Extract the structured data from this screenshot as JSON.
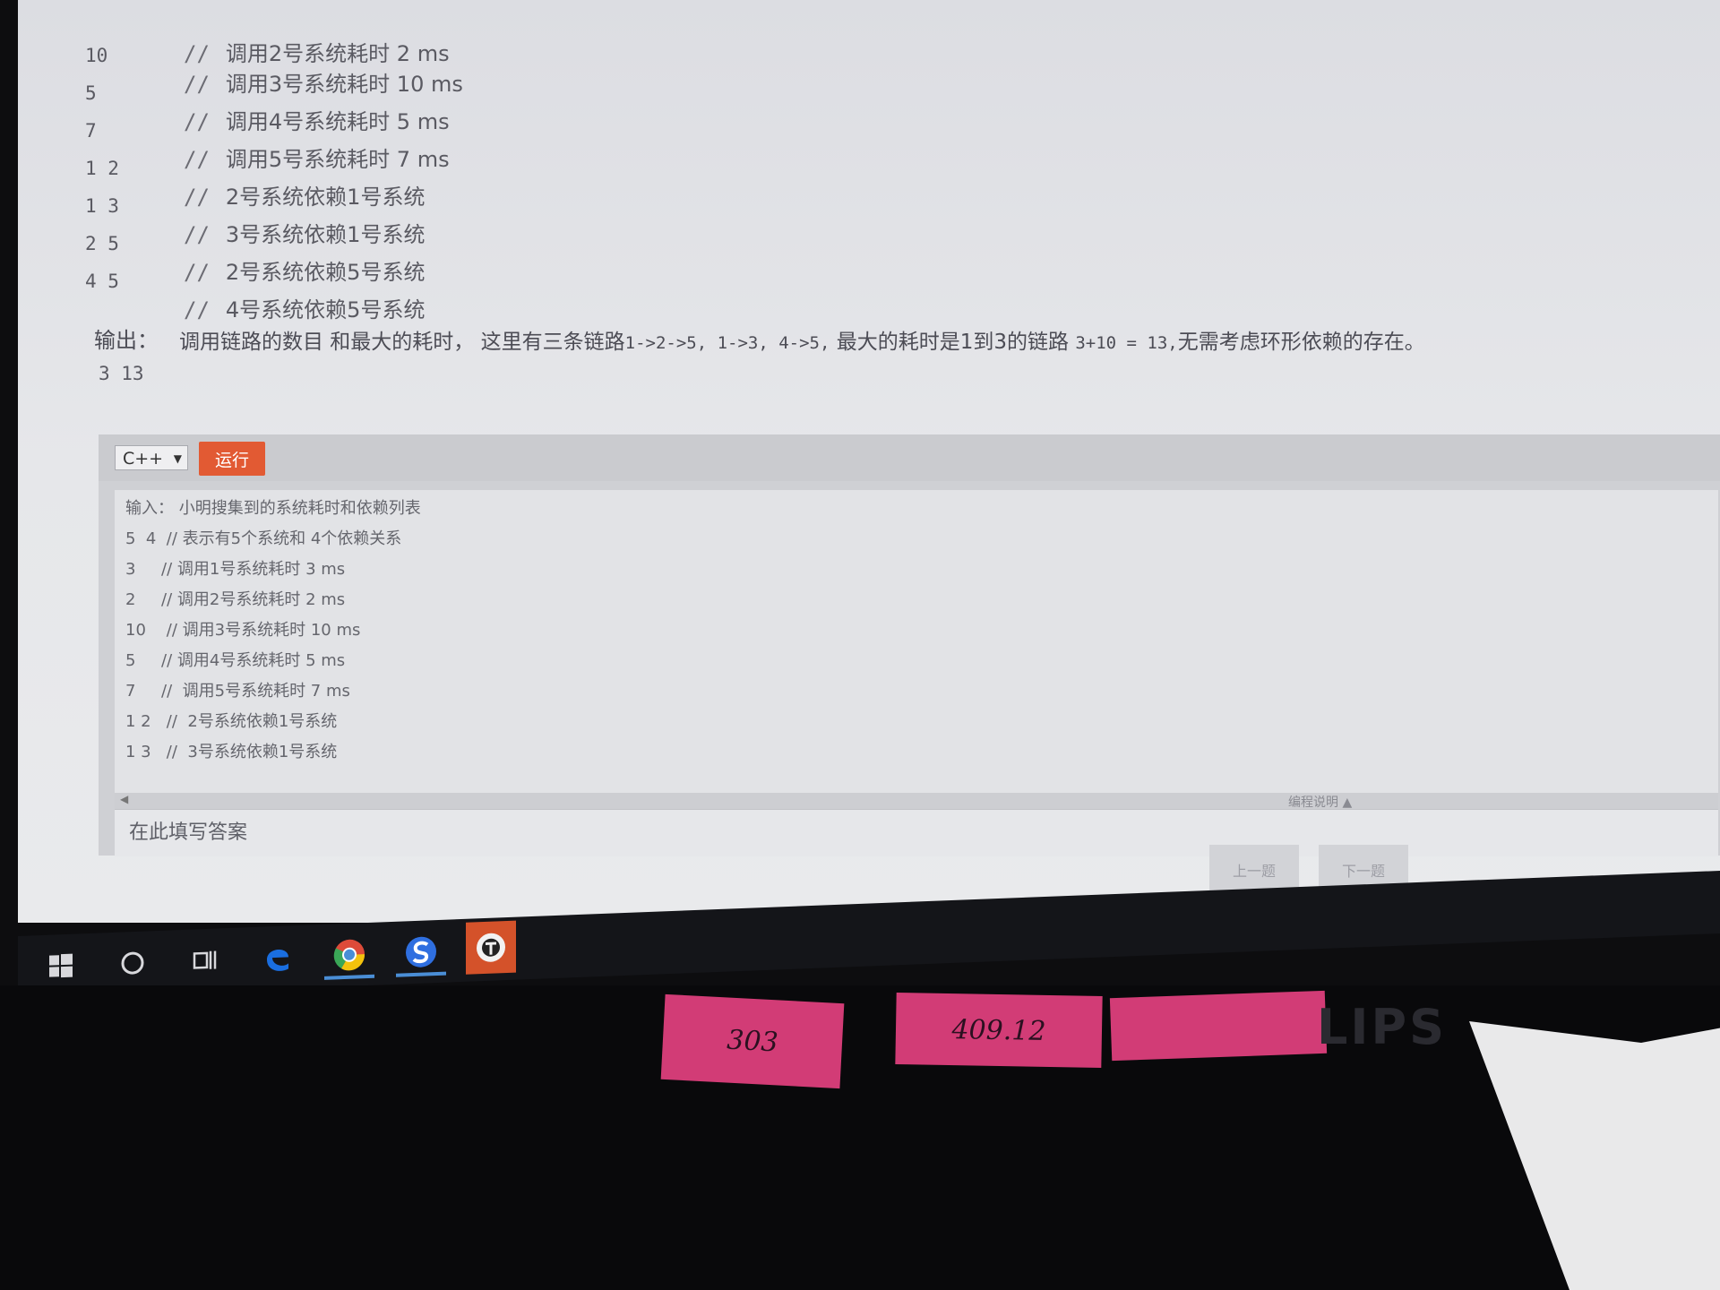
{
  "problem": {
    "sample_input_lines": [
      {
        "num": "",
        "comment": "调用2号系统耗时 2 ms"
      },
      {
        "num": "10",
        "comment": "调用3号系统耗时 10 ms"
      },
      {
        "num": "5",
        "comment": "调用4号系统耗时 5 ms"
      },
      {
        "num": "7",
        "comment": "调用5号系统耗时 7 ms"
      },
      {
        "num": "1 2",
        "comment": "2号系统依赖1号系统"
      },
      {
        "num": "1 3",
        "comment": "3号系统依赖1号系统"
      },
      {
        "num": "2 5",
        "comment": "2号系统依赖5号系统"
      },
      {
        "num": "4 5",
        "comment": "4号系统依赖5号系统"
      }
    ],
    "comment_prefix": "//",
    "output_label": "输出：",
    "output_desc_a": "调用链路的数目 和最大的耗时， 这里有三条链路",
    "output_desc_b": "1->2->5, 1->3, 4->5,",
    "output_desc_c": "最大的耗时是1到3的链路",
    "output_desc_d": "3+10 = 13,",
    "output_desc_e": "无需考虑环形依赖的存在。",
    "output_value": "3  13"
  },
  "editor": {
    "language": "C++",
    "run_label": "运行",
    "code_lines": [
      "输入： 小明搜集到的系统耗时和依赖列表",
      "5  4  // 表示有5个系统和 4个依赖关系",
      "3     // 调用1号系统耗时 3 ms",
      "2     // 调用2号系统耗时 2 ms",
      "10    // 调用3号系统耗时 10 ms",
      "5     // 调用4号系统耗时 5 ms",
      "7     //  调用5号系统耗时 7 ms",
      "1 2   //  2号系统依赖1号系统",
      "1 3   //  3号系统依赖1号系统"
    ],
    "programming_note": "编程说明 ▲",
    "answer_placeholder": "在此填写答案"
  },
  "nav": {
    "prev": "上一题",
    "next": "下一题"
  },
  "taskbar": {
    "icons": [
      "windows-start-icon",
      "cortana-search-icon",
      "task-view-icon",
      "edge-icon",
      "chrome-icon",
      "sogou-icon",
      "app-icon"
    ]
  },
  "desk": {
    "sticky_labels": [
      "303",
      "409.12"
    ],
    "brand": "LIPS"
  },
  "colors": {
    "run_button": "#e25a33",
    "taskbar": "#141519",
    "sticky": "#d23c76"
  }
}
